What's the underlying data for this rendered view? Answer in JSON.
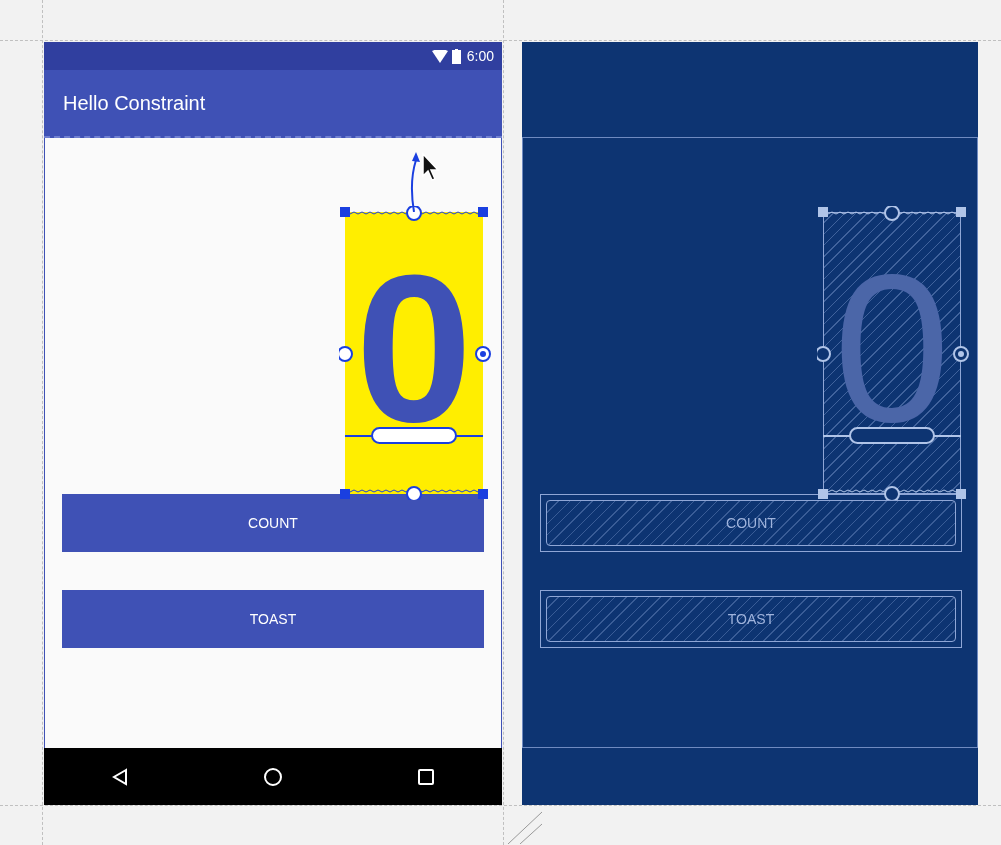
{
  "design": {
    "status_time": "6:00",
    "title": "Hello Constraint",
    "count_text": "0",
    "buttons": [
      "COUNT",
      "TOAST"
    ]
  },
  "blueprint": {
    "count_text": "0",
    "buttons": [
      "COUNT",
      "TOAST"
    ]
  }
}
